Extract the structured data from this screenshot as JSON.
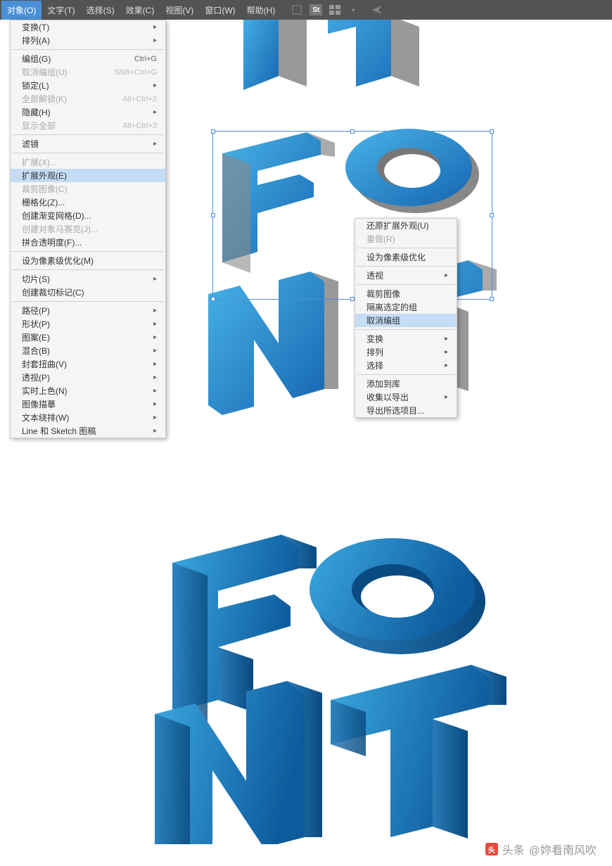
{
  "menubar": {
    "items": [
      {
        "label": "对象(O)",
        "active": true
      },
      {
        "label": "文字(T)"
      },
      {
        "label": "选择(S)"
      },
      {
        "label": "效果(C)"
      },
      {
        "label": "视图(V)"
      },
      {
        "label": "窗口(W)"
      },
      {
        "label": "帮助(H)"
      }
    ]
  },
  "main_menu": {
    "groups": [
      [
        {
          "label": "变换(T)",
          "submenu": true
        },
        {
          "label": "排列(A)",
          "submenu": true
        }
      ],
      [
        {
          "label": "编组(G)",
          "shortcut": "Ctrl+G"
        },
        {
          "label": "取消编组(U)",
          "shortcut": "Shift+Ctrl+G",
          "disabled": true
        },
        {
          "label": "锁定(L)",
          "submenu": true
        },
        {
          "label": "全部解锁(K)",
          "shortcut": "Alt+Ctrl+2",
          "disabled": true
        },
        {
          "label": "隐藏(H)",
          "submenu": true
        },
        {
          "label": "显示全部",
          "shortcut": "Alt+Ctrl+3",
          "disabled": true
        }
      ],
      [
        {
          "label": "滤镜",
          "submenu": true
        }
      ],
      [
        {
          "label": "扩展(X)...",
          "disabled": true
        },
        {
          "label": "扩展外观(E)",
          "highlighted": true
        },
        {
          "label": "裁剪图像(C)",
          "disabled": true
        },
        {
          "label": "栅格化(Z)..."
        },
        {
          "label": "创建渐变网格(D)..."
        },
        {
          "label": "创建对象马赛克(J)...",
          "disabled": true
        },
        {
          "label": "拼合透明度(F)..."
        }
      ],
      [
        {
          "label": "设为像素级优化(M)"
        }
      ],
      [
        {
          "label": "切片(S)",
          "submenu": true
        },
        {
          "label": "创建裁切标记(C)"
        }
      ],
      [
        {
          "label": "路径(P)",
          "submenu": true
        },
        {
          "label": "形状(P)",
          "submenu": true
        },
        {
          "label": "图案(E)",
          "submenu": true
        },
        {
          "label": "混合(B)",
          "submenu": true
        },
        {
          "label": "封套扭曲(V)",
          "submenu": true
        },
        {
          "label": "透视(P)",
          "submenu": true
        },
        {
          "label": "实时上色(N)",
          "submenu": true
        },
        {
          "label": "图像描摹",
          "submenu": true
        },
        {
          "label": "文本绕排(W)",
          "submenu": true
        },
        {
          "label": "Line 和 Sketch 图稿",
          "submenu": true
        }
      ]
    ]
  },
  "context_menu": {
    "groups": [
      [
        {
          "label": "还原扩展外观(U)"
        },
        {
          "label": "重做(R)",
          "disabled": true
        }
      ],
      [
        {
          "label": "设为像素级优化"
        }
      ],
      [
        {
          "label": "透视",
          "submenu": true
        }
      ],
      [
        {
          "label": "裁剪图像"
        },
        {
          "label": "隔离选定的组"
        },
        {
          "label": "取消编组",
          "highlighted": true
        }
      ],
      [
        {
          "label": "变换",
          "submenu": true
        },
        {
          "label": "排列",
          "submenu": true
        },
        {
          "label": "选择",
          "submenu": true
        }
      ],
      [
        {
          "label": "添加到库"
        },
        {
          "label": "收集以导出",
          "submenu": true
        },
        {
          "label": "导出所选项目..."
        }
      ]
    ]
  },
  "watermark": {
    "prefix": "头条",
    "author": "@妳看南风吹"
  }
}
